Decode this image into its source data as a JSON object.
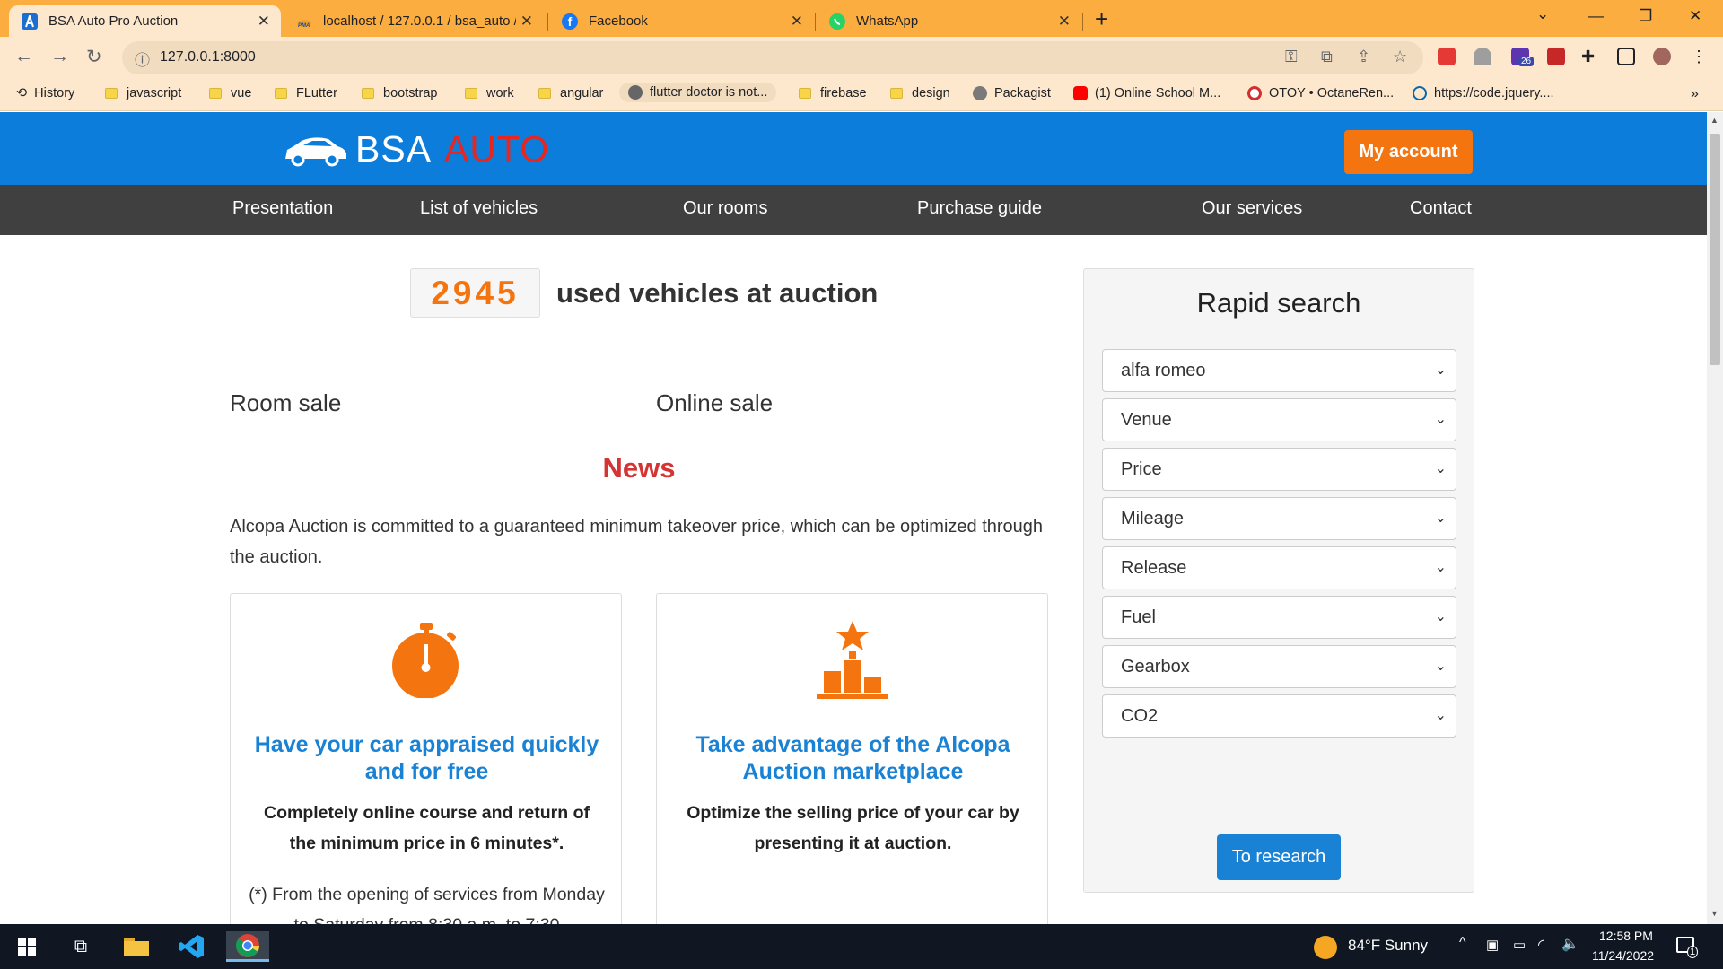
{
  "browser": {
    "tabs": [
      {
        "title": "BSA Auto Pro Auction",
        "active": true
      },
      {
        "title": "localhost / 127.0.0.1 / bsa_auto /",
        "active": false
      },
      {
        "title": "Facebook",
        "active": false
      },
      {
        "title": "WhatsApp",
        "active": false
      }
    ],
    "url": "127.0.0.1:8000",
    "bookmarks": [
      "History",
      "javascript",
      "vue",
      "FLutter",
      "bootstrap",
      "work",
      "angular",
      "flutter doctor is not...",
      "firebase",
      "design",
      "Packagist",
      "(1) Online School M...",
      "OTOY • OctaneRen...",
      "https://code.jquery...."
    ],
    "extension_badge": "26"
  },
  "site": {
    "logo": {
      "part1": "BSA",
      "part2": "AUTO"
    },
    "my_account": "My account",
    "nav": [
      "Presentation",
      "List of vehicles",
      "Our rooms",
      "Purchase guide",
      "Our services",
      "Contact"
    ],
    "vehicle_count": "2945",
    "vehicle_count_label": "used vehicles at auction",
    "room_sale": "Room sale",
    "online_sale": "Online sale",
    "news_title": "News",
    "news_text": "Alcopa Auction is committed to a guaranteed minimum takeover price, which can be optimized through the auction.",
    "cards": [
      {
        "title": "Have your car appraised quickly and for free",
        "body": "Completely online course and return of the minimum price in 6 minutes*.",
        "note": "(*) From the opening of services from Monday to Saturday from 8:30 a.m. to 7:30"
      },
      {
        "title": "Take advantage of the Alcopa Auction marketplace",
        "body": "Optimize the selling price of your car by presenting it at auction."
      }
    ],
    "rapid_search": {
      "title": "Rapid search",
      "selects": [
        "alfa romeo",
        "Venue",
        "Price",
        "Mileage",
        "Release",
        "Fuel",
        "Gearbox",
        "CO2"
      ],
      "button": "To research"
    },
    "colors": {
      "header": "#0d7ddc",
      "nav": "#404040",
      "accent": "#f4740f",
      "news": "#d43434",
      "link": "#1a82d4"
    }
  },
  "taskbar": {
    "weather": "84°F  Sunny",
    "time": "12:58 PM",
    "date": "11/24/2022",
    "notifications": "1"
  }
}
